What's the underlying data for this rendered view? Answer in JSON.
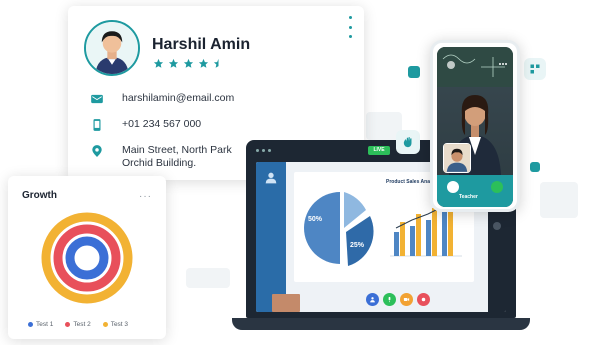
{
  "profile": {
    "name": "Harshil Amin",
    "rating": 4.5,
    "email": "harshilamin@email.com",
    "phone": "+01 234 567 000",
    "address_line1": "Main Street, North Park",
    "address_line2": "Orchid Building."
  },
  "growth": {
    "title": "Growth",
    "legend": [
      {
        "label": "Test 1",
        "color": "#3b6fd6"
      },
      {
        "label": "Test 2",
        "color": "#e8505b"
      },
      {
        "label": "Test 3",
        "color": "#f2b233"
      }
    ]
  },
  "laptop": {
    "live_label": "LIVE",
    "slide_percent_a": "50%",
    "slide_percent_b": "25%",
    "slide_title": "Product Sales Analysis"
  },
  "phone": {
    "caller_label": "Teacher"
  },
  "colors": {
    "accent": "#1e9aa0",
    "dark": "#1b2330"
  }
}
